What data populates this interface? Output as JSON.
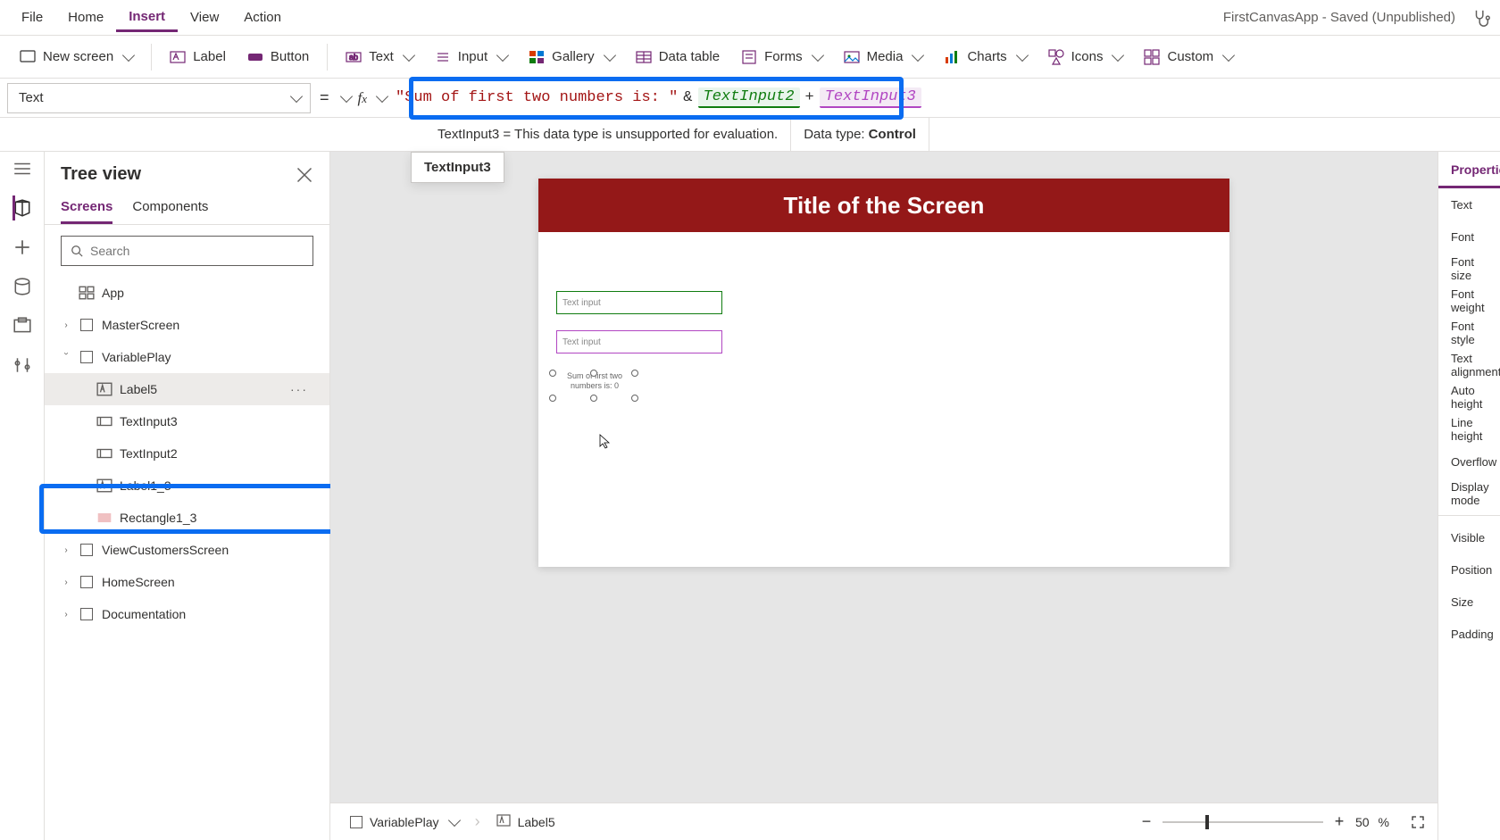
{
  "menubar": {
    "file": "File",
    "home": "Home",
    "insert": "Insert",
    "view": "View",
    "action": "Action",
    "title": "FirstCanvasApp - Saved (Unpublished)"
  },
  "ribbon": {
    "newscreen": "New screen",
    "label": "Label",
    "button": "Button",
    "text": "Text",
    "input": "Input",
    "gallery": "Gallery",
    "datatable": "Data table",
    "forms": "Forms",
    "media": "Media",
    "charts": "Charts",
    "icons": "Icons",
    "custom": "Custom"
  },
  "formula": {
    "prop": "Text",
    "str": "\"Sum of first two numbers is: \"",
    "p1": "TextInput2",
    "p2": "TextInput3"
  },
  "inforow": {
    "left": "TextInput3  =  This data type is unsupported for evaluation.",
    "dt_label": "Data type:",
    "dt_value": "Control"
  },
  "floater": "TextInput3",
  "tree": {
    "title": "Tree view",
    "tabs": {
      "screens": "Screens",
      "components": "Components"
    },
    "search_ph": "Search",
    "items": {
      "app": "App",
      "master": "MasterScreen",
      "varplay": "VariablePlay",
      "label5": "Label5",
      "ti3": "TextInput3",
      "ti2": "TextInput2",
      "l13": "Label1_3",
      "rect": "Rectangle1_3",
      "vcs": "ViewCustomersScreen",
      "hs": "HomeScreen",
      "doc": "Documentation"
    }
  },
  "canvas": {
    "title": "Title of the Screen",
    "ti_ph": "Text input",
    "label_text": "Sum of first two numbers is: 0"
  },
  "status": {
    "screen": "VariablePlay",
    "sel": "Label5",
    "zoom": "50",
    "pct": "%"
  },
  "props": {
    "tab": "Properties",
    "rows": {
      "r1": "Text",
      "r2": "Font",
      "r3": "Font size",
      "r4": "Font weight",
      "r5": "Font style",
      "r6": "Text alignment",
      "r7": "Auto height",
      "r8": "Line height",
      "r9": "Overflow",
      "r10": "Display mode",
      "r11": "Visible",
      "r12": "Position",
      "r13": "Size",
      "r14": "Padding"
    }
  }
}
